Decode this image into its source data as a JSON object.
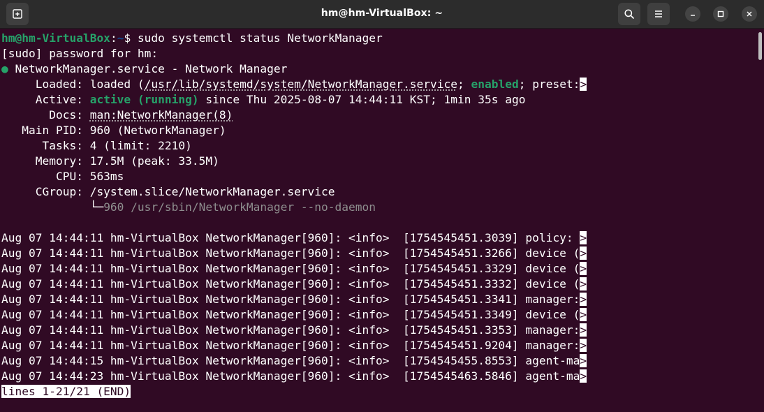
{
  "window": {
    "title": "hm@hm-VirtualBox: ~"
  },
  "prompt": {
    "user_host": "hm@hm-VirtualBox",
    "separator": ":",
    "path": "~",
    "symbol": "$ ",
    "command": "sudo systemctl status NetworkManager"
  },
  "sudo_line": "[sudo] password for hm:",
  "service": {
    "bullet": "●",
    "name_line": " NetworkManager.service - Network Manager",
    "loaded_label": "     Loaded: ",
    "loaded_pre": "loaded (",
    "loaded_path": "/usr/lib/systemd/system/NetworkManager.service",
    "loaded_sep": "; ",
    "loaded_enabled": "enabled",
    "loaded_post": "; preset:",
    "truncation_marker": ">",
    "active_label": "     Active: ",
    "active_state": "active (running)",
    "active_rest": " since Thu 2025-08-07 14:44:11 KST; 1min 35s ago",
    "docs_label": "       Docs: ",
    "docs_value": "man:NetworkManager(8)",
    "pid_line": "   Main PID: 960 (NetworkManager)",
    "tasks_line": "      Tasks: 4 (limit: 2210)",
    "memory_line": "     Memory: 17.5M (peak: 33.5M)",
    "cpu_line": "        CPU: 563ms",
    "cgroup_line": "     CGroup: /system.slice/NetworkManager.service",
    "cgroup_tree": "             └─",
    "cgroup_child": "960 /usr/sbin/NetworkManager --no-daemon"
  },
  "logs": [
    "Aug 07 14:44:11 hm-VirtualBox NetworkManager[960]: <info>  [1754545451.3039] policy: ",
    "Aug 07 14:44:11 hm-VirtualBox NetworkManager[960]: <info>  [1754545451.3266] device (",
    "Aug 07 14:44:11 hm-VirtualBox NetworkManager[960]: <info>  [1754545451.3329] device (",
    "Aug 07 14:44:11 hm-VirtualBox NetworkManager[960]: <info>  [1754545451.3332] device (",
    "Aug 07 14:44:11 hm-VirtualBox NetworkManager[960]: <info>  [1754545451.3341] manager:",
    "Aug 07 14:44:11 hm-VirtualBox NetworkManager[960]: <info>  [1754545451.3349] device (",
    "Aug 07 14:44:11 hm-VirtualBox NetworkManager[960]: <info>  [1754545451.3353] manager:",
    "Aug 07 14:44:11 hm-VirtualBox NetworkManager[960]: <info>  [1754545451.9204] manager:",
    "Aug 07 14:44:15 hm-VirtualBox NetworkManager[960]: <info>  [1754545455.8553] agent-ma",
    "Aug 07 14:44:23 hm-VirtualBox NetworkManager[960]: <info>  [1754545463.5846] agent-ma"
  ],
  "pager_status": "lines 1-21/21 (END)",
  "icons": {
    "new_tab": "new-tab-icon",
    "search": "search-icon",
    "menu": "hamburger-menu-icon",
    "minimize": "minimize-icon",
    "maximize": "maximize-icon",
    "close": "close-icon"
  },
  "colors": {
    "background": "#300a24",
    "titlebar": "#2c2c2c",
    "prompt_user": "#26a269",
    "prompt_path": "#12488b",
    "active_green": "#26a269"
  }
}
